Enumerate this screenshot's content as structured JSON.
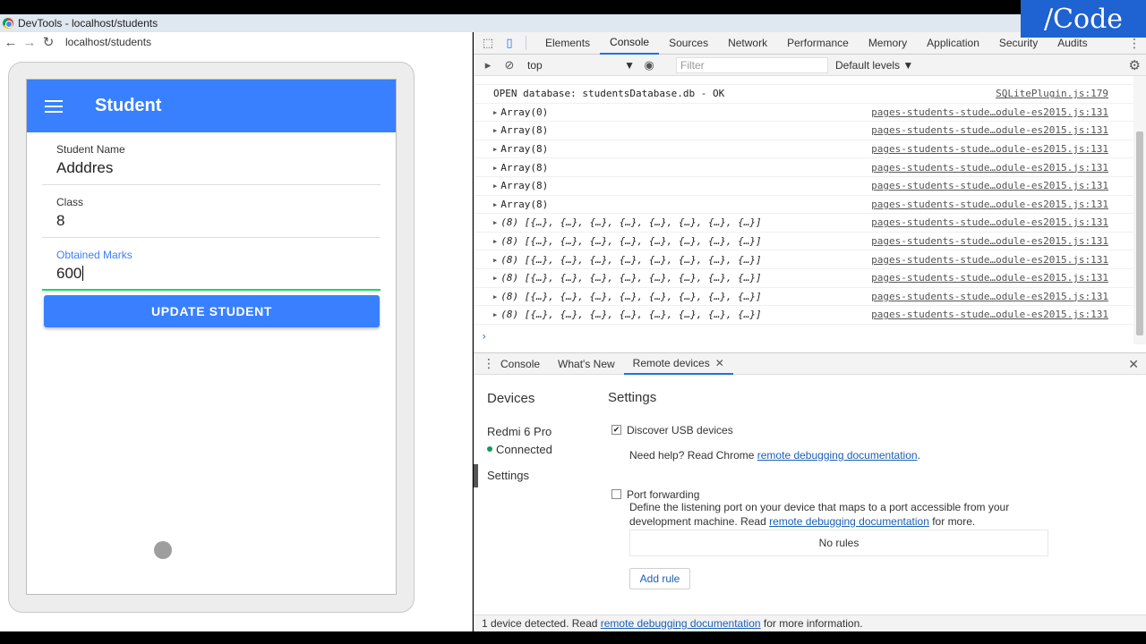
{
  "brand": "/Code",
  "window": {
    "title": "DevTools - localhost/students"
  },
  "browser": {
    "url": "localhost/students"
  },
  "app": {
    "title": "Student",
    "fields": [
      {
        "label": "Student Name",
        "value": "Adddres"
      },
      {
        "label": "Class",
        "value": "8"
      },
      {
        "label": "Obtained Marks",
        "value": "600"
      }
    ],
    "update_button": "UPDATE STUDENT"
  },
  "devtools": {
    "tabs": [
      "Elements",
      "Console",
      "Sources",
      "Network",
      "Performance",
      "Memory",
      "Application",
      "Security",
      "Audits"
    ],
    "active_tab": "Console",
    "context": "top",
    "filter_placeholder": "Filter",
    "levels": "Default levels ▼",
    "console_rows": [
      {
        "msg": "OPEN database: studentsDatabase.db - OK",
        "src": "SQLitePlugin.js:179"
      },
      {
        "msg": "Array(0)",
        "src": "pages-students-stude…odule-es2015.js:131",
        "expandable": true
      },
      {
        "msg": "Array(8)",
        "src": "pages-students-stude…odule-es2015.js:131",
        "expandable": true
      },
      {
        "msg": "Array(8)",
        "src": "pages-students-stude…odule-es2015.js:131",
        "expandable": true
      },
      {
        "msg": "Array(8)",
        "src": "pages-students-stude…odule-es2015.js:131",
        "expandable": true
      },
      {
        "msg": "Array(8)",
        "src": "pages-students-stude…odule-es2015.js:131",
        "expandable": true
      },
      {
        "msg": "Array(8)",
        "src": "pages-students-stude…odule-es2015.js:131",
        "expandable": true
      },
      {
        "msg": "(8) [{…}, {…}, {…}, {…}, {…}, {…}, {…}, {…}]",
        "src": "pages-students-stude…odule-es2015.js:131",
        "expandable": true,
        "obj": true
      },
      {
        "msg": "(8) [{…}, {…}, {…}, {…}, {…}, {…}, {…}, {…}]",
        "src": "pages-students-stude…odule-es2015.js:131",
        "expandable": true,
        "obj": true
      },
      {
        "msg": "(8) [{…}, {…}, {…}, {…}, {…}, {…}, {…}, {…}]",
        "src": "pages-students-stude…odule-es2015.js:131",
        "expandable": true,
        "obj": true
      },
      {
        "msg": "(8) [{…}, {…}, {…}, {…}, {…}, {…}, {…}, {…}]",
        "src": "pages-students-stude…odule-es2015.js:131",
        "expandable": true,
        "obj": true
      },
      {
        "msg": "(8) [{…}, {…}, {…}, {…}, {…}, {…}, {…}, {…}]",
        "src": "pages-students-stude…odule-es2015.js:131",
        "expandable": true,
        "obj": true
      },
      {
        "msg": "(8) [{…}, {…}, {…}, {…}, {…}, {…}, {…}, {…}]",
        "src": "pages-students-stude…odule-es2015.js:131",
        "expandable": true,
        "obj": true
      }
    ],
    "prompt": "›",
    "drawer_tabs": [
      "Console",
      "What's New",
      "Remote devices"
    ],
    "drawer_active": "Remote devices"
  },
  "remote": {
    "devices_heading": "Devices",
    "device_name": "Redmi 6 Pro",
    "device_status": "Connected",
    "settings_item": "Settings",
    "settings_heading": "Settings",
    "discover_label": "Discover USB devices",
    "discover_checked": true,
    "help_prefix": "Need help? Read Chrome ",
    "help_link": "remote debugging documentation",
    "help_suffix": ".",
    "port_label": "Port forwarding",
    "port_checked": false,
    "port_desc_1": "Define the listening port on your device that maps to a port accessible from your",
    "port_desc_2_prefix": "development machine. Read ",
    "port_desc_link": "remote debugging documentation",
    "port_desc_suffix": " for more.",
    "no_rules": "No rules",
    "add_rule": "Add rule"
  },
  "footer": {
    "prefix": "1 device detected. Read ",
    "link": "remote debugging documentation",
    "suffix": " for more information."
  }
}
